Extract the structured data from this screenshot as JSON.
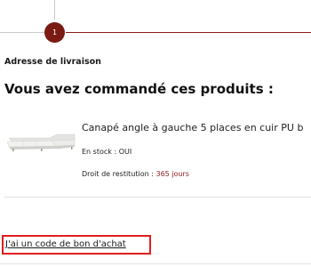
{
  "stepper": {
    "current_step": "1"
  },
  "shipping": {
    "label": "Adresse de livraison"
  },
  "order": {
    "heading": "Vous avez commandé ces produits :"
  },
  "product": {
    "name": "Canapé angle à gauche 5 places en cuir PU b",
    "stock_label": "En stock : ",
    "stock_value": "OUI",
    "return_label": "Droit de restitution : ",
    "return_value": "365 jours",
    "image_icon": "sofa-image"
  },
  "voucher": {
    "link_text": "J'ai un code de bon d'achat"
  },
  "colors": {
    "accent": "#7a1a12",
    "highlight_box": "#e01e1e",
    "return_value": "#8b1a1a"
  }
}
